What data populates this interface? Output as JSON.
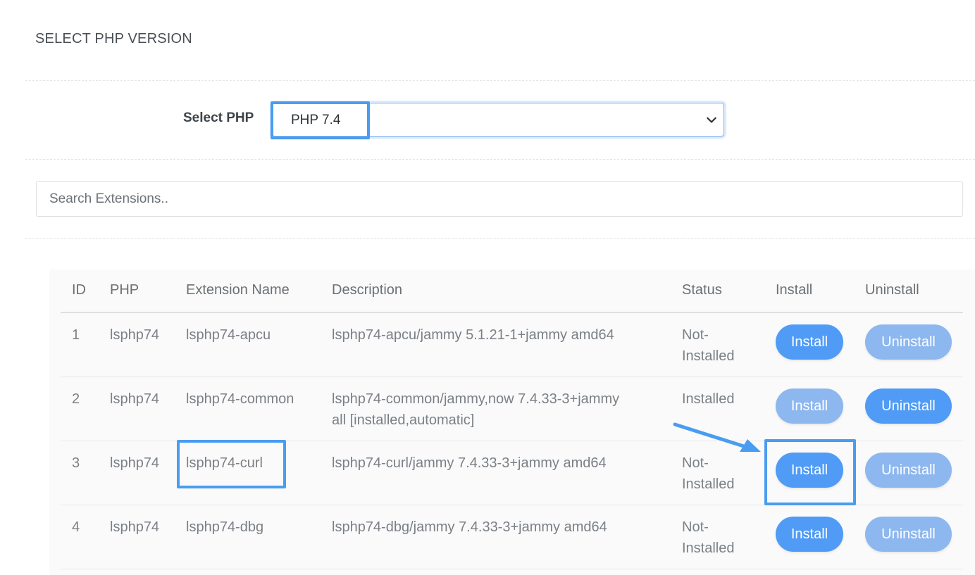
{
  "header": {
    "title": "SELECT PHP VERSION"
  },
  "select": {
    "label": "Select PHP",
    "value": "PHP 7.4"
  },
  "search": {
    "placeholder": "Search Extensions.."
  },
  "table": {
    "columns": [
      "ID",
      "PHP",
      "Extension Name",
      "Description",
      "Status",
      "Install",
      "Uninstall"
    ],
    "rows": [
      {
        "id": "1",
        "php": "lsphp74",
        "name": "lsphp74-apcu",
        "description_line1": "lsphp74-apcu/jammy 5.1.21-1+jammy amd64",
        "description_line2": "",
        "status_line1": "Not-",
        "status_line2": "Installed",
        "install_label": "Install",
        "uninstall_label": "Uninstall",
        "install_enabled": true,
        "uninstall_enabled": false
      },
      {
        "id": "2",
        "php": "lsphp74",
        "name": "lsphp74-common",
        "description_line1": "lsphp74-common/jammy,now 7.4.33-3+jammy",
        "description_line2": "all [installed,automatic]",
        "status_line1": "Installed",
        "status_line2": "",
        "install_label": "Install",
        "uninstall_label": "Uninstall",
        "install_enabled": false,
        "uninstall_enabled": true
      },
      {
        "id": "3",
        "php": "lsphp74",
        "name": "lsphp74-curl",
        "description_line1": "lsphp74-curl/jammy 7.4.33-3+jammy amd64",
        "description_line2": "",
        "status_line1": "Not-",
        "status_line2": "Installed",
        "install_label": "Install",
        "uninstall_label": "Uninstall",
        "install_enabled": true,
        "uninstall_enabled": false
      },
      {
        "id": "4",
        "php": "lsphp74",
        "name": "lsphp74-dbg",
        "description_line1": "lsphp74-dbg/jammy 7.4.33-3+jammy amd64",
        "description_line2": "",
        "status_line1": "Not-",
        "status_line2": "Installed",
        "install_label": "Install",
        "uninstall_label": "Uninstall",
        "install_enabled": true,
        "uninstall_enabled": false
      }
    ]
  },
  "colors": {
    "accent": "#4f9bf5",
    "accent_disabled": "#8db7ef",
    "highlight": "#4a9cf0"
  },
  "icons": {
    "select_chevron": "chevron-down-icon",
    "annotation_arrow": "arrow-icon"
  }
}
